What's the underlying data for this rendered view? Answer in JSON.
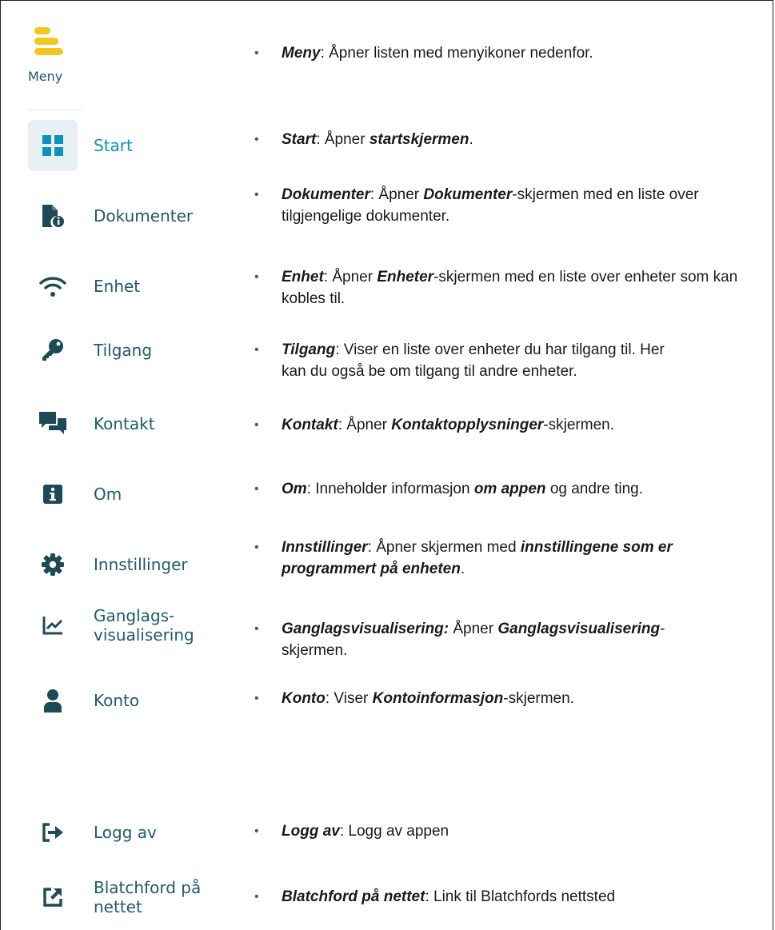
{
  "menu": {
    "header_label": "Meny",
    "items": [
      {
        "label": "Start",
        "icon": "grid-icon"
      },
      {
        "label": "Dokumenter",
        "icon": "document-info-icon"
      },
      {
        "label": "Enhet",
        "icon": "wifi-icon"
      },
      {
        "label": "Tilgang",
        "icon": "key-icon"
      },
      {
        "label": "Kontakt",
        "icon": "chat-bubbles-icon"
      },
      {
        "label": "Om",
        "icon": "info-icon"
      },
      {
        "label": "Innstillinger",
        "icon": "gear-icon"
      },
      {
        "label": "Ganglags-\nvisualisering",
        "icon": "line-chart-icon"
      },
      {
        "label": "Konto",
        "icon": "user-icon"
      },
      {
        "label": "Logg av",
        "icon": "logout-icon"
      },
      {
        "label": "Blatchford på\nnettet",
        "icon": "external-link-icon"
      }
    ]
  },
  "descriptions": [
    {
      "parts": [
        {
          "t": "Meny",
          "b": true
        },
        {
          "t": ": Åpner listen med menyikoner nedenfor."
        }
      ]
    },
    {
      "parts": [
        {
          "t": "Start",
          "b": true
        },
        {
          "t": ": Åpner "
        },
        {
          "t": "startskjermen",
          "b": true
        },
        {
          "t": "."
        }
      ]
    },
    {
      "parts": [
        {
          "t": "Dokumenter",
          "b": true
        },
        {
          "t": ": Åpner "
        },
        {
          "t": "Dokumenter",
          "b": true
        },
        {
          "t": "-skjermen med en liste over tilgjengelige dokumenter."
        }
      ]
    },
    {
      "parts": [
        {
          "t": "Enhet",
          "b": true
        },
        {
          "t": ": Åpner "
        },
        {
          "t": "Enheter",
          "b": true
        },
        {
          "t": "-skjermen med en liste over enheter som kan kobles til."
        }
      ]
    },
    {
      "parts": [
        {
          "t": "Tilgang",
          "b": true
        },
        {
          "t": ": Viser en liste over enheter du har tilgang til. Her kan du også be om tilgang til andre enheter."
        }
      ]
    },
    {
      "parts": [
        {
          "t": "Kontakt",
          "b": true
        },
        {
          "t": ": Åpner "
        },
        {
          "t": "Kontaktopplysninger",
          "b": true
        },
        {
          "t": "-skjermen."
        }
      ]
    },
    {
      "parts": [
        {
          "t": "Om",
          "b": true
        },
        {
          "t": ": Inneholder informasjon "
        },
        {
          "t": "om appen",
          "b": true
        },
        {
          "t": " og andre ting."
        }
      ]
    },
    {
      "parts": [
        {
          "t": "Innstillinger",
          "b": true
        },
        {
          "t": ": Åpner skjermen med "
        },
        {
          "t": "innstillingene som er programmert på enheten",
          "b": true
        },
        {
          "t": "."
        }
      ]
    },
    {
      "parts": [
        {
          "t": "Ganglagsvisualisering:",
          "b": true
        },
        {
          "t": " Åpner "
        },
        {
          "t": "Ganglagsvisualisering",
          "b": true
        },
        {
          "t": "-skjermen."
        }
      ]
    },
    {
      "parts": [
        {
          "t": "Konto",
          "b": true
        },
        {
          "t": ": Viser "
        },
        {
          "t": "Kontoinformasjon",
          "b": true
        },
        {
          "t": "-skjermen."
        }
      ]
    },
    {
      "parts": [
        {
          "t": "Logg av",
          "b": true
        },
        {
          "t": ": Logg av appen"
        }
      ]
    },
    {
      "parts": [
        {
          "t": "Blatchford på nettet",
          "b": true
        },
        {
          "t": ": Link til Blatchfords nettsted"
        }
      ]
    }
  ],
  "colors": {
    "accent": "#0e93b8",
    "text": "#1d5b68",
    "icon": "#1d4a55",
    "logo": "#f2c81f"
  }
}
